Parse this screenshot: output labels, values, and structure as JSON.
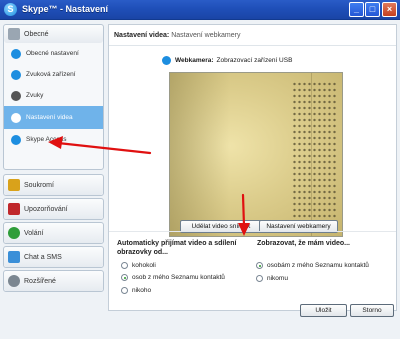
{
  "window": {
    "app_icon_glyph": "S",
    "title": "Skype™ - Nastavení",
    "controls": {
      "minimize": "_",
      "maximize": "□",
      "close": "×"
    }
  },
  "sidebar": {
    "sections": [
      {
        "label": "Obecné",
        "icon": "general-icon",
        "color": "#9aa6b2",
        "items": [
          {
            "label": "Obecné nastavení",
            "icon": "skype-icon",
            "color": "#1d8ee0"
          },
          {
            "label": "Zvuková zařízení",
            "icon": "audio-devices-icon",
            "color": "#1d8ee0"
          },
          {
            "label": "Zvuky",
            "icon": "sounds-icon",
            "color": "#555555"
          },
          {
            "label": "Nastavení videa",
            "icon": "webcam-icon",
            "color": "#ffffff",
            "selected": true
          },
          {
            "label": "Skype Access",
            "icon": "skype-access-icon",
            "color": "#1d8ee0"
          }
        ]
      },
      {
        "label": "Soukromí",
        "icon": "lock-icon",
        "color": "#d9a21b"
      },
      {
        "label": "Upozorňování",
        "icon": "flag-icon",
        "color": "#c0282c"
      },
      {
        "label": "Volání",
        "icon": "phone-icon",
        "color": "#2f9d3a"
      },
      {
        "label": "Chat a SMS",
        "icon": "chat-icon",
        "color": "#3a8fd8"
      },
      {
        "label": "Rozšířené",
        "icon": "gear-icon",
        "color": "#7c8791"
      }
    ]
  },
  "content": {
    "breadcrumb_main": "Nastavení videa:",
    "breadcrumb_sub": "Nastavení webkamery",
    "webcam_label": "Webkamera:",
    "webcam_value": "Zobrazovací zařízení USB",
    "snapshot_button": "Udělat video snímek",
    "webcam_settings_button": "Nastavení webkamery",
    "auto_accept": {
      "title": "Automaticky přijímat video a sdílení obrazovky od...",
      "options": [
        {
          "label": "kohokoli",
          "selected": false
        },
        {
          "label": "osob z mého Seznamu kontaktů",
          "selected": true
        },
        {
          "label": "nikoho",
          "selected": false
        }
      ]
    },
    "show_video": {
      "title": "Zobrazovat, že mám video...",
      "options": [
        {
          "label": "osobám z mého Seznamu kontaktů",
          "selected": true
        },
        {
          "label": "nikomu",
          "selected": false
        }
      ]
    }
  },
  "footer": {
    "save_label": "Uložit",
    "cancel_label": "Storno"
  },
  "colors": {
    "titlebar": "#1f4fb8",
    "selected_item": "#6fb3ea",
    "annotation_arrow": "#e01010"
  }
}
